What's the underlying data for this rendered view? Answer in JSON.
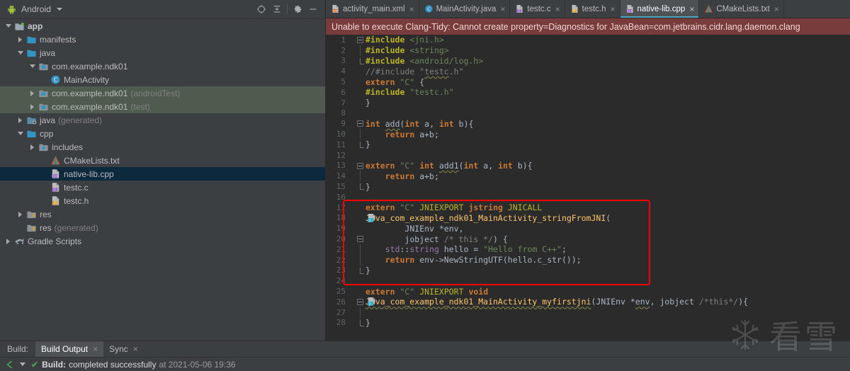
{
  "project_panel": {
    "title": "Android",
    "caret_icon": "chevron-down-icon",
    "toolbar": [
      {
        "name": "select-opened-file-icon",
        "label": "⊕"
      },
      {
        "name": "collapse-all-icon",
        "label": "≡"
      },
      {
        "name": "gear-icon",
        "label": "⚙"
      },
      {
        "name": "minimize-icon",
        "label": "—"
      }
    ],
    "tree": [
      {
        "label": "app",
        "sub": "",
        "depth": 0,
        "arrow": "open",
        "icon": "module-icon",
        "bold": true,
        "state": "normal"
      },
      {
        "label": "manifests",
        "sub": "",
        "depth": 1,
        "arrow": "closed",
        "icon": "folder-icon",
        "bold": false,
        "state": "normal"
      },
      {
        "label": "java",
        "sub": "",
        "depth": 1,
        "arrow": "open",
        "icon": "folder-icon",
        "bold": false,
        "state": "normal"
      },
      {
        "label": "com.example.ndk01",
        "sub": "",
        "depth": 2,
        "arrow": "open",
        "icon": "package-icon",
        "bold": false,
        "state": "normal"
      },
      {
        "label": "MainActivity",
        "sub": "",
        "depth": 3,
        "arrow": "none",
        "icon": "class-icon",
        "bold": false,
        "state": "normal"
      },
      {
        "label": "com.example.ndk01",
        "sub": "(androidTest)",
        "depth": 2,
        "arrow": "closed",
        "icon": "package-icon",
        "bold": false,
        "state": "test"
      },
      {
        "label": "com.example.ndk01",
        "sub": "(test)",
        "depth": 2,
        "arrow": "closed",
        "icon": "package-icon",
        "bold": false,
        "state": "test"
      },
      {
        "label": "java",
        "sub": "(generated)",
        "depth": 1,
        "arrow": "closed",
        "icon": "folder-generated-icon",
        "bold": false,
        "state": "normal"
      },
      {
        "label": "cpp",
        "sub": "",
        "depth": 1,
        "arrow": "open",
        "icon": "folder-icon",
        "bold": false,
        "state": "normal"
      },
      {
        "label": "includes",
        "sub": "",
        "depth": 2,
        "arrow": "closed",
        "icon": "includes-icon",
        "bold": false,
        "state": "normal"
      },
      {
        "label": "CMakeLists.txt",
        "sub": "",
        "depth": 3,
        "arrow": "none",
        "icon": "cmake-icon",
        "bold": false,
        "state": "normal"
      },
      {
        "label": "native-lib.cpp",
        "sub": "",
        "depth": 3,
        "arrow": "none",
        "icon": "cpp-file-icon",
        "bold": false,
        "state": "selected"
      },
      {
        "label": "testc.c",
        "sub": "",
        "depth": 3,
        "arrow": "none",
        "icon": "c-file-icon",
        "bold": false,
        "state": "normal"
      },
      {
        "label": "testc.h",
        "sub": "",
        "depth": 3,
        "arrow": "none",
        "icon": "h-file-icon",
        "bold": false,
        "state": "normal"
      },
      {
        "label": "res",
        "sub": "",
        "depth": 1,
        "arrow": "closed",
        "icon": "res-icon",
        "bold": false,
        "state": "normal"
      },
      {
        "label": "res",
        "sub": "(generated)",
        "depth": 1,
        "arrow": "none",
        "icon": "res-icon",
        "bold": false,
        "state": "normal"
      },
      {
        "label": "Gradle Scripts",
        "sub": "",
        "depth": 0,
        "arrow": "closed",
        "icon": "gradle-icon",
        "bold": false,
        "state": "normal"
      }
    ]
  },
  "editor": {
    "tabs": [
      {
        "label": "activity_main.xml",
        "icon": "xml-file-icon",
        "active": false,
        "close": "×"
      },
      {
        "label": "MainActivity.java",
        "icon": "java-class-icon",
        "active": false,
        "close": "×"
      },
      {
        "label": "testc.c",
        "icon": "c-file-icon",
        "active": false,
        "close": "×"
      },
      {
        "label": "testc.h",
        "icon": "h-file-icon",
        "active": false,
        "close": "×"
      },
      {
        "label": "native-lib.cpp",
        "icon": "cpp-file-icon",
        "active": true,
        "close": "×"
      },
      {
        "label": "CMakeLists.txt",
        "icon": "cmake-icon",
        "active": false,
        "close": "×"
      }
    ],
    "error_banner": "Unable to execute Clang-Tidy: Cannot create property=Diagnostics for JavaBean=com.jetbrains.cidr.lang.daemon.clang",
    "code_lines": [
      {
        "n": "1",
        "fold": "start",
        "bar": false,
        "jni": false,
        "html": "<span class=\"pre\">#include</span> <span class=\"str\">&lt;jni.h&gt;</span>"
      },
      {
        "n": "2",
        "fold": "",
        "bar": true,
        "jni": false,
        "html": "<span class=\"pre\">#include</span> <span class=\"str\">&lt;string&gt;</span>"
      },
      {
        "n": "3",
        "fold": "end",
        "bar": false,
        "jni": false,
        "html": "<span class=\"pre\">#include</span> <span class=\"str\">&lt;android/log.h&gt;</span>"
      },
      {
        "n": "4",
        "fold": "",
        "bar": false,
        "jni": false,
        "html": "<span class=\"cmt\">//#include \"<span class=\"wavyg\">testc</span>.h\"</span>"
      },
      {
        "n": "5",
        "fold": "",
        "bar": false,
        "jni": false,
        "html": "<span class=\"kw\">extern</span> <span class=\"str\">\"C\"</span> <span class=\"plain\">{</span>"
      },
      {
        "n": "6",
        "fold": "",
        "bar": false,
        "jni": false,
        "html": "<span class=\"pre\">#include</span> <span class=\"str\">\"testc.h\"</span>"
      },
      {
        "n": "7",
        "fold": "",
        "bar": false,
        "jni": false,
        "html": "<span class=\"plain\">}</span>"
      },
      {
        "n": "8",
        "fold": "",
        "bar": false,
        "jni": false,
        "html": ""
      },
      {
        "n": "9",
        "fold": "start",
        "bar": false,
        "jni": false,
        "html": "<span class=\"kw\">int</span> <span class=\"plain wavyg\">add</span><span class=\"plain\">(</span><span class=\"kw\">int</span> <span class=\"plain\">a, </span><span class=\"kw\">int</span> <span class=\"plain\">b){</span>"
      },
      {
        "n": "10",
        "fold": "",
        "bar": true,
        "jni": false,
        "html": "    <span class=\"kw\">return</span> <span class=\"plain\">a+b;</span>"
      },
      {
        "n": "11",
        "fold": "end",
        "bar": false,
        "jni": false,
        "html": "<span class=\"plain\">}</span>"
      },
      {
        "n": "12",
        "fold": "",
        "bar": false,
        "jni": false,
        "html": ""
      },
      {
        "n": "13",
        "fold": "start",
        "bar": false,
        "jni": false,
        "html": "<span class=\"kw\">extern</span> <span class=\"str\">\"C\"</span> <span class=\"kw\">int</span> <span class=\"plain wavyg\">add1</span><span class=\"plain\">(</span><span class=\"kw\">int</span> <span class=\"plain\">a, </span><span class=\"kw\">int</span> <span class=\"plain\">b){</span>"
      },
      {
        "n": "14",
        "fold": "",
        "bar": true,
        "jni": false,
        "html": "    <span class=\"kw\">return</span> <span class=\"plain\">a+b;</span>"
      },
      {
        "n": "15",
        "fold": "end",
        "bar": false,
        "jni": false,
        "html": "<span class=\"plain\">}</span>"
      },
      {
        "n": "16",
        "fold": "",
        "bar": false,
        "jni": false,
        "html": ""
      },
      {
        "n": "17",
        "fold": "",
        "bar": false,
        "jni": false,
        "html": "<span class=\"kw\">extern</span> <span class=\"str\">\"C\"</span> <span class=\"macro\">JNIEXPORT</span> <span class=\"kw\">jstring</span> <span class=\"macro\">JNICALL</span>"
      },
      {
        "n": "18",
        "fold": "",
        "bar": false,
        "jni": true,
        "html": "<span class=\"fn\">Java_com_example_ndk01_MainActivity_stringFromJNI</span><span class=\"plain\">(</span>"
      },
      {
        "n": "19",
        "fold": "",
        "bar": false,
        "jni": false,
        "html": "        <span class=\"plain\">JNIEnv *env,</span>"
      },
      {
        "n": "20",
        "fold": "start",
        "bar": false,
        "jni": false,
        "html": "        <span class=\"plain\">jobject </span><span class=\"cmt\">/* this */</span><span class=\"plain\">) {</span>"
      },
      {
        "n": "21",
        "fold": "",
        "bar": true,
        "jni": false,
        "html": "    <span class=\"purple\">std</span><span class=\"plain\">::</span><span class=\"purple\">string</span><span class=\"plain\"> hello = </span><span class=\"str\">\"Hello from C++\"</span><span class=\"plain\">;</span>"
      },
      {
        "n": "22",
        "fold": "",
        "bar": true,
        "jni": false,
        "html": "    <span class=\"kw\">return</span> <span class=\"plain\">env-&gt;NewStringUTF(hello.c_str());</span>"
      },
      {
        "n": "23",
        "fold": "end",
        "bar": false,
        "jni": false,
        "html": "<span class=\"plain\">}</span>"
      },
      {
        "n": "24",
        "fold": "",
        "bar": false,
        "jni": false,
        "html": ""
      },
      {
        "n": "25",
        "fold": "",
        "bar": false,
        "jni": false,
        "html": "<span class=\"kw\">extern</span> <span class=\"str\">\"C\"</span> <span class=\"macro\">JNIEXPORT</span> <span class=\"kw\">void</span>"
      },
      {
        "n": "26",
        "fold": "start",
        "bar": false,
        "jni": true,
        "html": "<span class=\"fn wavyg\">Java_com_example_ndk01_MainActivity_myfirstjni</span><span class=\"plain\">(JNIEnv *</span><span class=\"plain wavyg\">env</span><span class=\"plain\">, jobject </span><span class=\"cmt\">/*this*/</span><span class=\"plain\">){</span>"
      },
      {
        "n": "27",
        "fold": "",
        "bar": true,
        "jni": false,
        "html": ""
      },
      {
        "n": "28",
        "fold": "end",
        "bar": false,
        "jni": false,
        "html": "<span class=\"plain\">}</span>"
      }
    ],
    "highlight_box": {
      "color": "#ff0000"
    }
  },
  "build_panel": {
    "label": "Build:",
    "tabs": [
      {
        "label": "Build Output",
        "active": true,
        "close": "×"
      },
      {
        "label": "Sync",
        "active": false,
        "close": "×"
      }
    ],
    "status": {
      "check_icon": "✔",
      "bold_text": "Build:",
      "normal_text": "completed successfully",
      "dim_text": "at 2021-05-06 19:36"
    }
  },
  "watermark": {
    "snowflake": "❆",
    "text": "看雪"
  }
}
